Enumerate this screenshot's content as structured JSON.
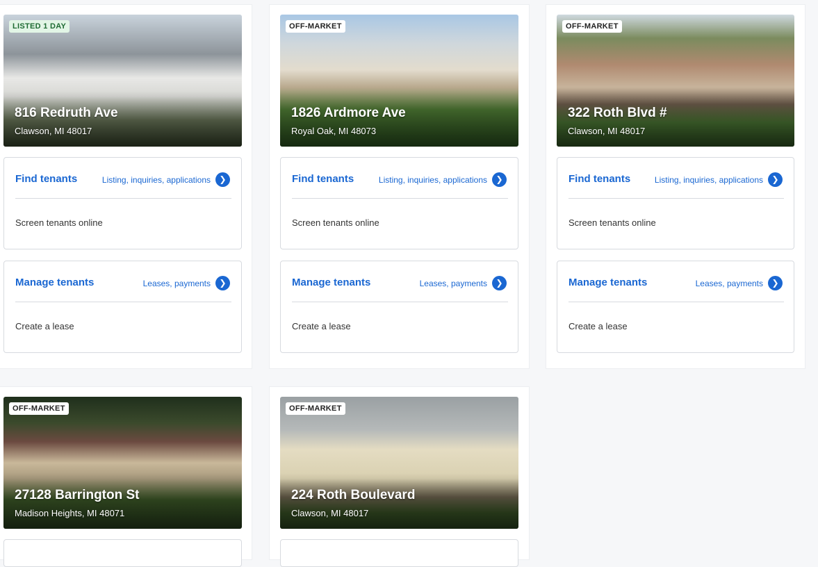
{
  "colors": {
    "accent": "#1a67d2",
    "page_bg": "#f6f7f9"
  },
  "properties": [
    {
      "badge": "LISTED 1 DAY",
      "address": "816 Redruth Ave",
      "city": "Clawson, MI 48017",
      "find": {
        "title": "Find tenants",
        "subtitle": "Listing, inquiries, applications",
        "link": "Screen tenants online"
      },
      "manage": {
        "title": "Manage tenants",
        "subtitle": "Leases, payments",
        "link": "Create a lease"
      }
    },
    {
      "badge": "OFF-MARKET",
      "address": "1826 Ardmore Ave",
      "city": "Royal Oak, MI 48073",
      "find": {
        "title": "Find tenants",
        "subtitle": "Listing, inquiries, applications",
        "link": "Screen tenants online"
      },
      "manage": {
        "title": "Manage tenants",
        "subtitle": "Leases, payments",
        "link": "Create a lease"
      }
    },
    {
      "badge": "OFF-MARKET",
      "address": "322 Roth Blvd #",
      "city": "Clawson, MI 48017",
      "find": {
        "title": "Find tenants",
        "subtitle": "Listing, inquiries, applications",
        "link": "Screen tenants online"
      },
      "manage": {
        "title": "Manage tenants",
        "subtitle": "Leases, payments",
        "link": "Create a lease"
      }
    },
    {
      "badge": "OFF-MARKET",
      "address": "27128 Barrington St",
      "city": "Madison Heights, MI 48071"
    },
    {
      "badge": "OFF-MARKET",
      "address": "224 Roth Boulevard",
      "city": "Clawson, MI 48017"
    }
  ]
}
